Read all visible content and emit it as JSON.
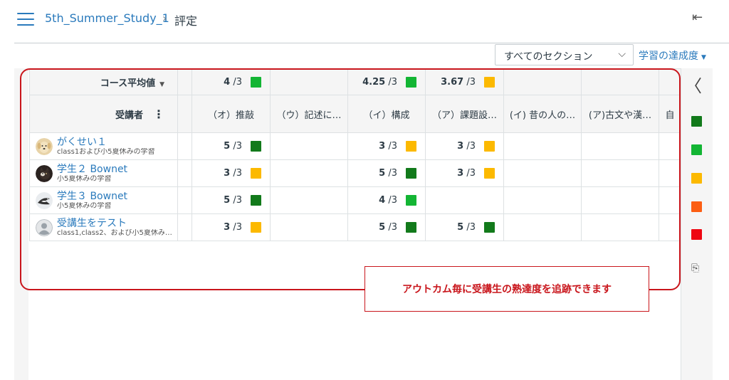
{
  "header": {
    "course": "5th_Summer_Study_1",
    "separator": "›",
    "page": "評定",
    "collapse_icon": "⇤"
  },
  "toolbar": {
    "section_select": "すべてのセクション",
    "mastery_link": "学習の達成度"
  },
  "grid": {
    "average_label": "コース平均値",
    "student_header": "受講者",
    "columns": [
      "（オ）推敲",
      "（ウ）記述に…",
      "（イ）構成",
      "（ア）課題設…",
      "(イ) 昔の人の…",
      "(ア)古文や漢…",
      "自"
    ],
    "averages": [
      {
        "value": "4",
        "of": "/3",
        "color": "#13b534"
      },
      null,
      {
        "value": "4.25",
        "of": "/3",
        "color": "#13b534"
      },
      {
        "value": "3.67",
        "of": "/3",
        "color": "#fcb900"
      },
      null,
      null,
      null
    ],
    "students": [
      {
        "name": "がくせい１",
        "sections": "class1および小5夏休みの学習",
        "avatar": "dog",
        "scores": [
          {
            "value": "5",
            "of": "/3",
            "color": "#127a1b"
          },
          null,
          {
            "value": "3",
            "of": "/3",
            "color": "#fcb900"
          },
          {
            "value": "3",
            "of": "/3",
            "color": "#fcb900"
          },
          null,
          null,
          null
        ]
      },
      {
        "name": "学生２ Bownet",
        "sections": "小5夏休みの学習",
        "avatar": "cat",
        "scores": [
          {
            "value": "3",
            "of": "/3",
            "color": "#fcb900"
          },
          null,
          {
            "value": "5",
            "of": "/3",
            "color": "#127a1b"
          },
          {
            "value": "3",
            "of": "/3",
            "color": "#fcb900"
          },
          null,
          null,
          null
        ]
      },
      {
        "name": "学生３ Bownet",
        "sections": "小5夏休みの学習",
        "avatar": "bird",
        "scores": [
          {
            "value": "5",
            "of": "/3",
            "color": "#127a1b"
          },
          null,
          {
            "value": "4",
            "of": "/3",
            "color": "#13b534"
          },
          null,
          null,
          null,
          null
        ]
      },
      {
        "name": "受講生をテスト",
        "sections": "class1,class2、および小5夏休み…",
        "avatar": "default",
        "scores": [
          {
            "value": "3",
            "of": "/3",
            "color": "#fcb900"
          },
          null,
          {
            "value": "5",
            "of": "/3",
            "color": "#127a1b"
          },
          {
            "value": "5",
            "of": "/3",
            "color": "#127a1b"
          },
          null,
          null,
          null
        ]
      }
    ]
  },
  "legend": {
    "colors": [
      "#127a1b",
      "#13b534",
      "#fcb900",
      "#fc5e13",
      "#ee0612"
    ]
  },
  "annotation": {
    "text": "アウトカム毎に受講生の熟達度を追跡できます"
  }
}
